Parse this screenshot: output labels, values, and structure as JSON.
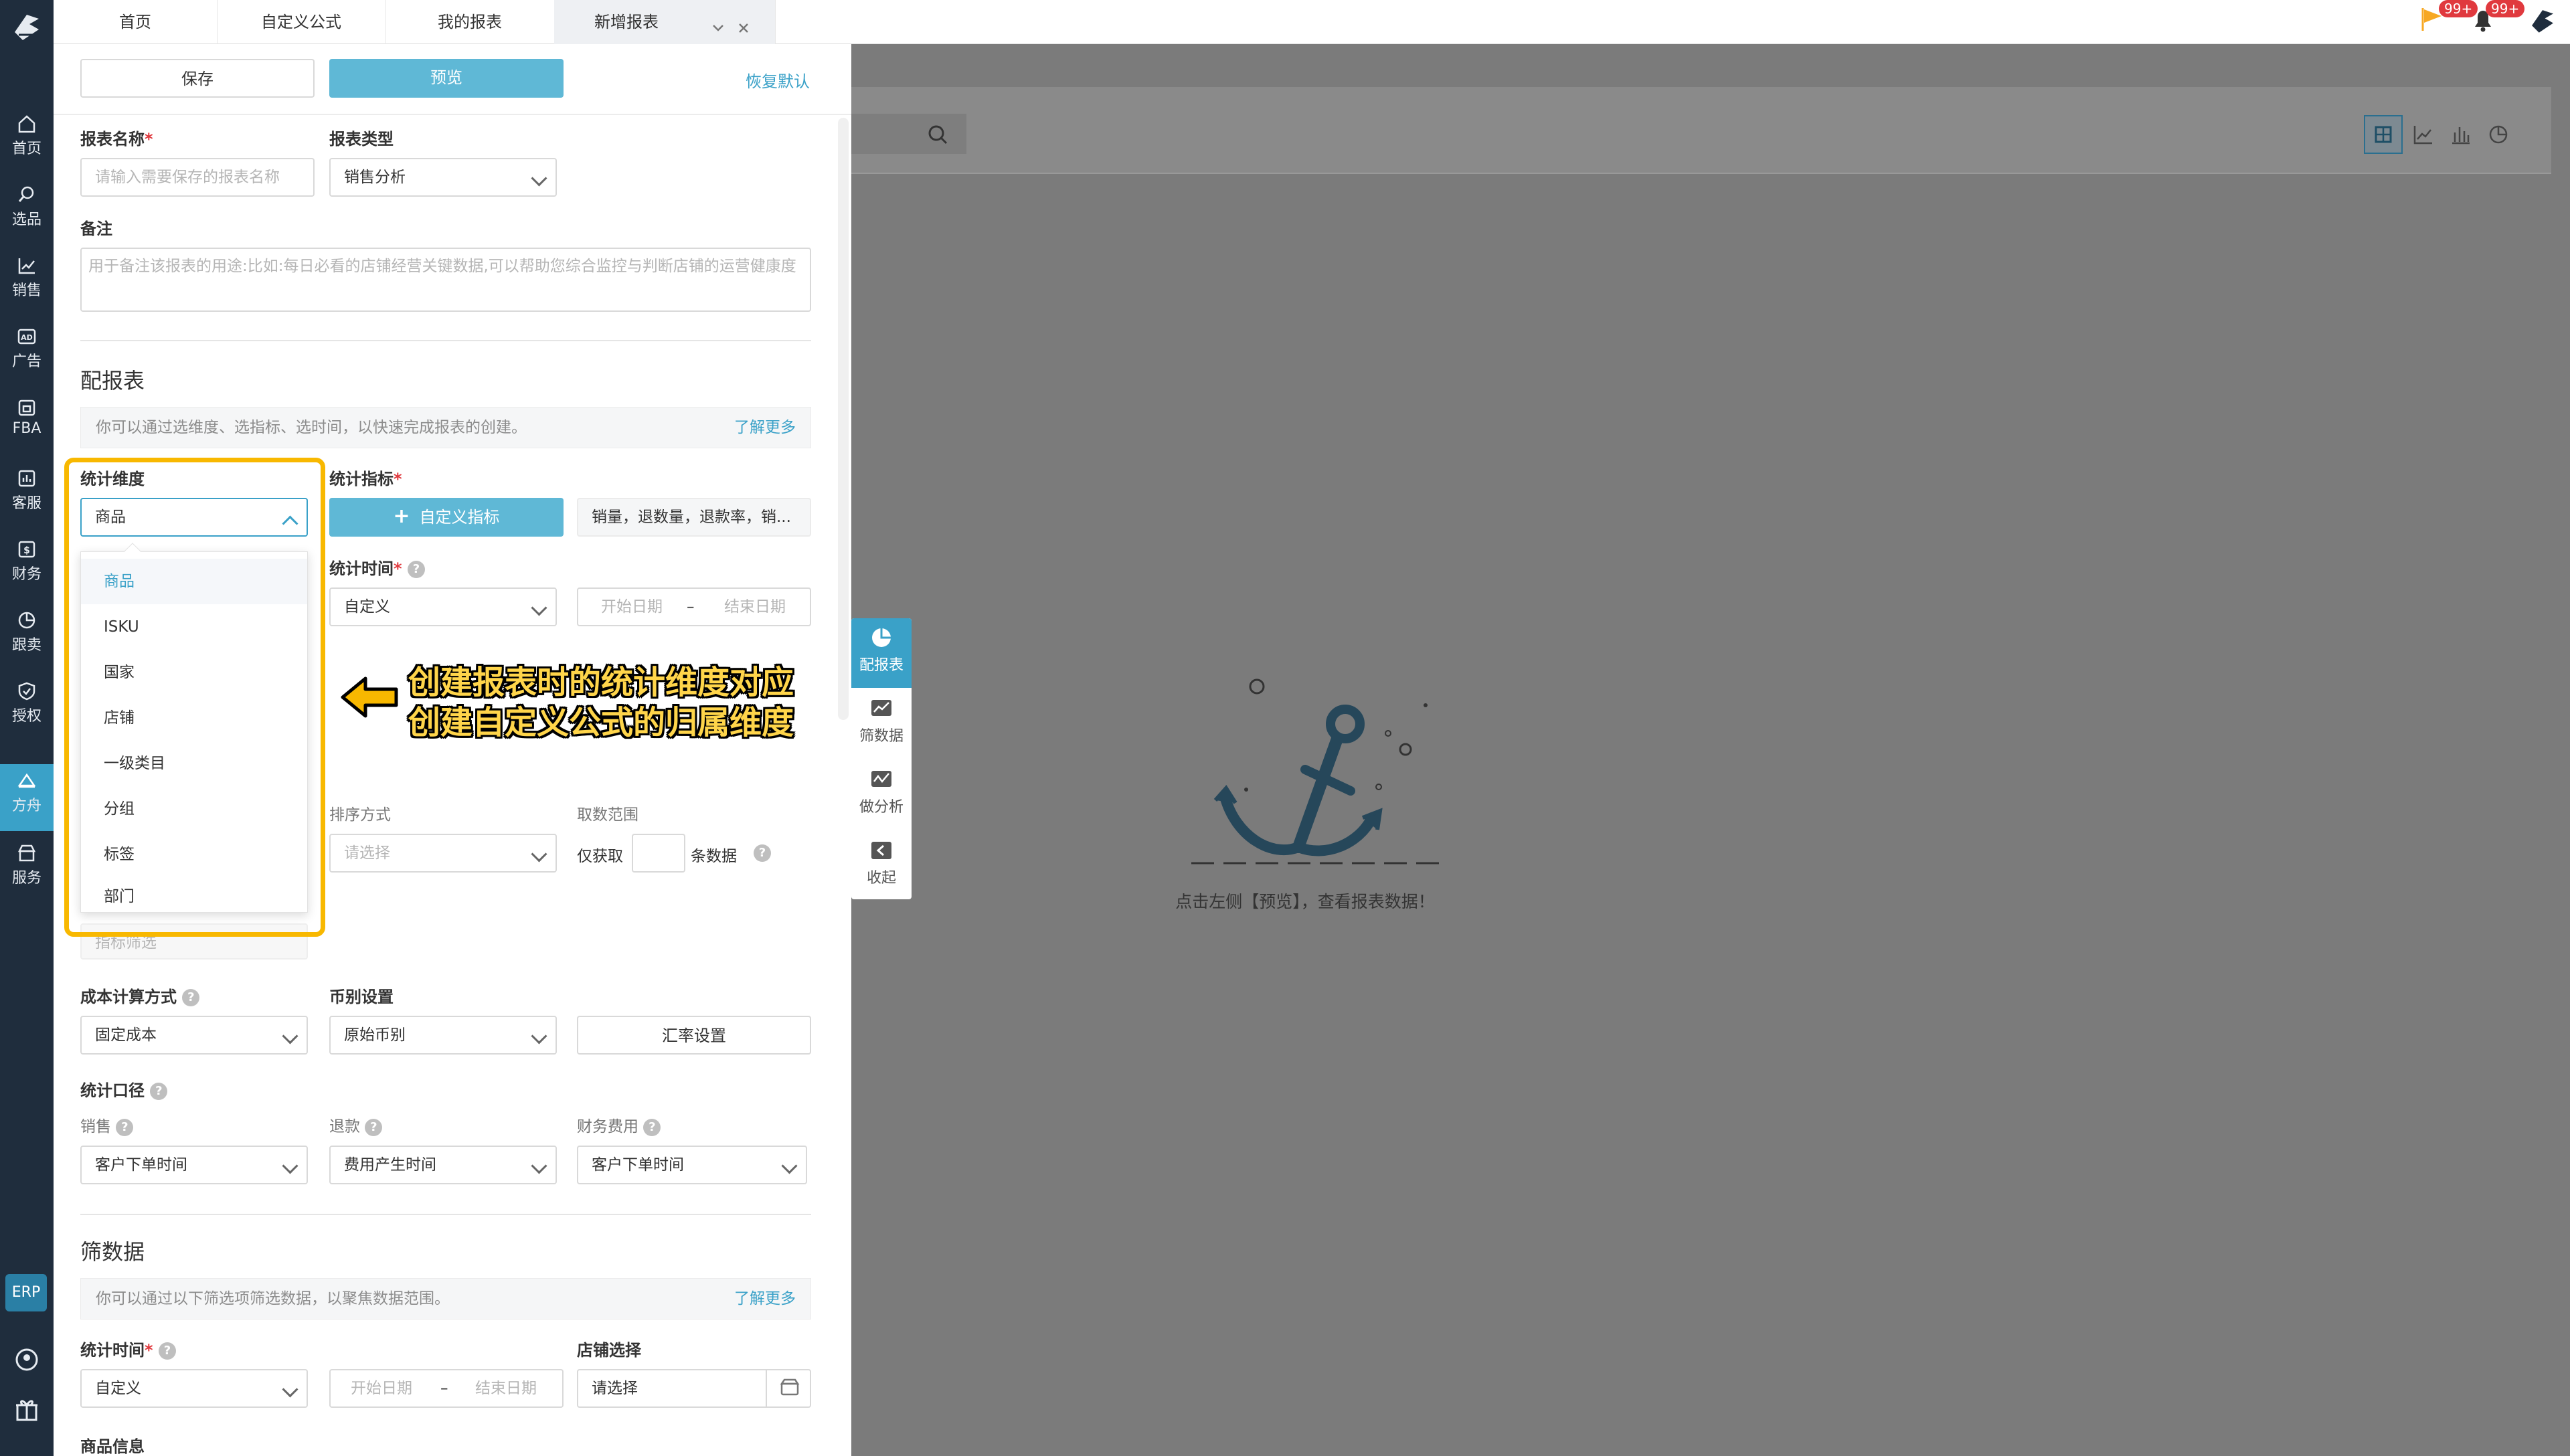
{
  "nav": {
    "items": [
      {
        "label": "首页",
        "icon": "home-icon"
      },
      {
        "label": "选品",
        "icon": "search-icon"
      },
      {
        "label": "销售",
        "icon": "trend-chart-icon"
      },
      {
        "label": "广告",
        "icon": "ad-icon"
      },
      {
        "label": "FBA",
        "icon": "warehouse-icon"
      },
      {
        "label": "客服",
        "icon": "service-chart-icon"
      },
      {
        "label": "财务",
        "icon": "finance-icon"
      },
      {
        "label": "跟卖",
        "icon": "pie-icon"
      },
      {
        "label": "授权",
        "icon": "shield-icon"
      },
      {
        "label": "方舟",
        "icon": "ark-icon"
      },
      {
        "label": "服务",
        "icon": "store-icon"
      }
    ],
    "erp_label": "ERP"
  },
  "tabs": {
    "items": [
      "首页",
      "自定义公式",
      "我的报表",
      "新增报表"
    ]
  },
  "header": {
    "badge1": "99+",
    "badge2": "99+"
  },
  "toolbar": {
    "save": "保存",
    "preview": "预览",
    "reset": "恢复默认"
  },
  "form": {
    "report_name_label": "报表名称",
    "report_name_placeholder": "请输入需要保存的报表名称",
    "report_type_label": "报表类型",
    "report_type_value": "销售分析",
    "note_label": "备注",
    "note_placeholder": "用于备注该报表的用途:比如:每日必看的店铺经营关键数据,可以帮助您综合监控与判断店铺的运营健康度"
  },
  "config": {
    "title": "配报表",
    "hint": "你可以通过选维度、选指标、选时间，以快速完成报表的创建。",
    "learn_more": "了解更多",
    "dimension_label": "统计维度",
    "dimension_value": "商品",
    "metric_label": "统计指标",
    "custom_metric_btn": "自定义指标",
    "metric_summary": "销量，退数量，退款率，销...",
    "time_label": "统计时间",
    "time_value": "自定义",
    "start_date": "开始日期",
    "end_date": "结束日期",
    "sort_label": "排序方式",
    "sort_placeholder": "请选择",
    "range_label": "取数范围",
    "range_prefix": "仅获取",
    "range_suffix": "条数据",
    "metric_filter": "指标筛选",
    "cost_label": "成本计算方式",
    "cost_value": "固定成本",
    "currency_label": "币别设置",
    "currency_value": "原始币别",
    "exchange_btn": "汇率设置",
    "caliber_label": "统计口径",
    "sales_label": "销售",
    "sales_value": "客户下单时间",
    "refund_label": "退款",
    "refund_value": "费用产生时间",
    "fee_label": "财务费用",
    "fee_value": "客户下单时间"
  },
  "dropdown": {
    "options": [
      "商品",
      "ISKU",
      "国家",
      "店铺",
      "一级类目",
      "分组",
      "标签",
      "部门"
    ]
  },
  "annotation": {
    "line1": "创建报表时的统计维度对应",
    "line2": "创建自定义公式的归属维度"
  },
  "filter": {
    "title": "筛数据",
    "hint": "你可以通过以下筛选项筛选数据，以聚焦数据范围。",
    "learn_more": "了解更多",
    "time_label": "统计时间",
    "time_value": "自定义",
    "start_date": "开始日期",
    "end_date": "结束日期",
    "store_label": "店铺选择",
    "store_placeholder": "请选择",
    "product_info_label": "商品信息"
  },
  "sidetools": {
    "items": [
      "配报表",
      "筛数据",
      "做分析",
      "收起"
    ]
  },
  "empty": {
    "text": "点击左侧【预览】，查看报表数据！"
  }
}
